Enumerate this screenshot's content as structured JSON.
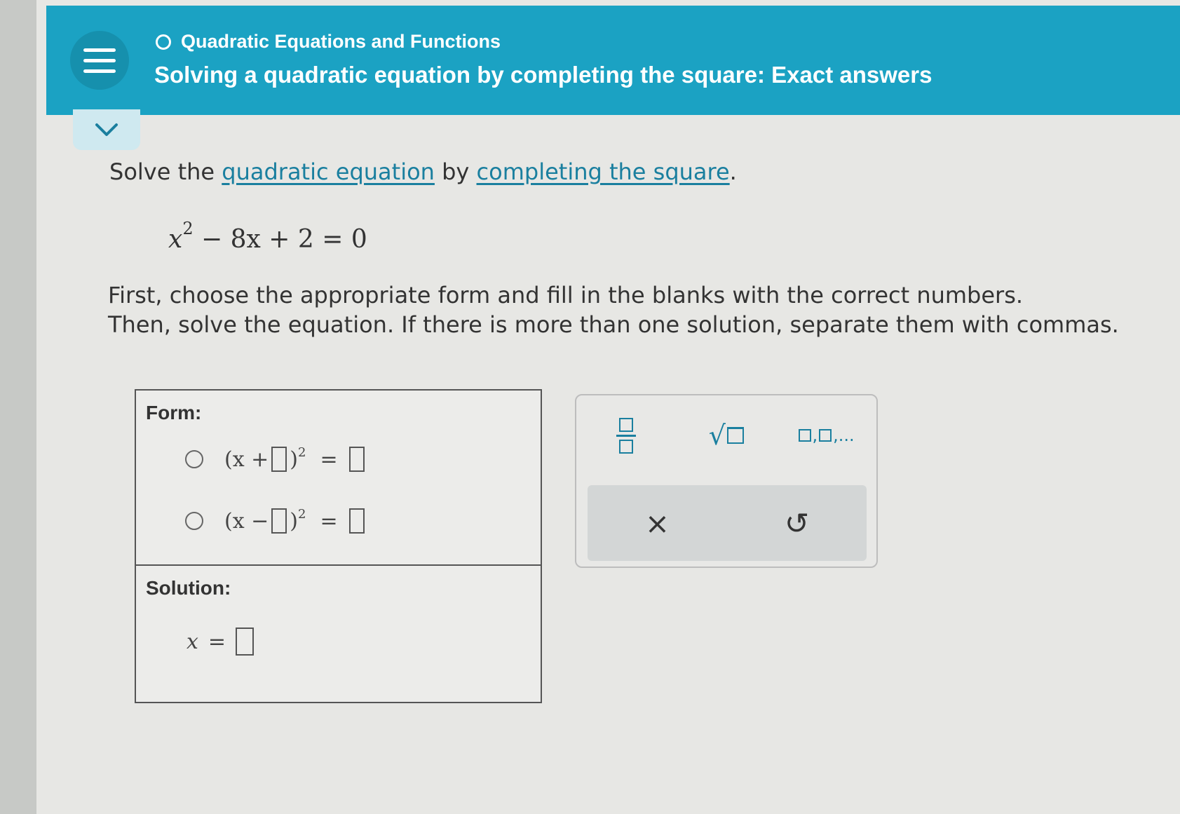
{
  "header": {
    "breadcrumb": "Quadratic Equations and Functions",
    "title": "Solving a quadratic equation by completing the square: Exact answers",
    "color": "#1ba2c3"
  },
  "problem": {
    "prompt_start": "Solve the ",
    "link1": "quadratic equation",
    "prompt_mid": " by ",
    "link2": "completing the square",
    "prompt_end": ".",
    "equation": {
      "x": "x",
      "exp": "2",
      "rest": " − 8x + 2 = 0"
    },
    "instruction_line1": "First, choose the appropriate form and fill in the blanks with the correct numbers.",
    "instruction_line2": "Then, solve the equation. If there is more than one solution, separate them with commas."
  },
  "answer": {
    "form_label": "Form:",
    "option1": {
      "open": "(x + ",
      "close": ")",
      "exp": "2",
      "eq": "="
    },
    "option2": {
      "open": "(x − ",
      "close": ")",
      "exp": "2",
      "eq": "="
    },
    "solution_label": "Solution:",
    "solution_var": "x",
    "solution_eq": "="
  },
  "keypad": {
    "list_suffix": ",...",
    "clear_symbol": "×",
    "undo_symbol": "↺",
    "accent": "#1a7f9f"
  }
}
